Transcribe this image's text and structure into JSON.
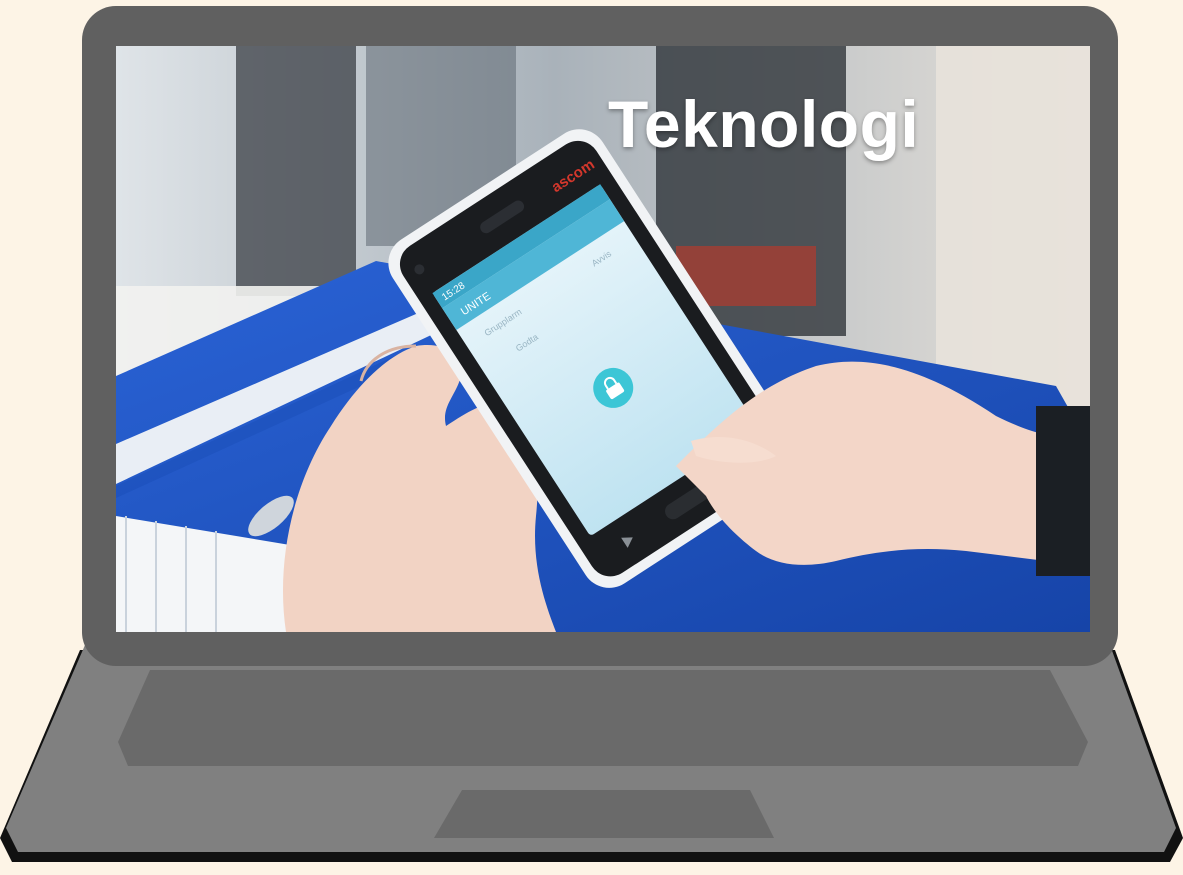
{
  "slide": {
    "title": "Teknologi"
  },
  "phone": {
    "brand": "ascom",
    "status_time": "15:28",
    "app_name": "UNITE",
    "row1": "Grupplarm",
    "row1_action": "Avvis",
    "row2": "Godta"
  },
  "colors": {
    "background": "#fdf4e6",
    "laptop_frame": "#606060",
    "laptop_base": "#808080",
    "keyboard": "#6a6a6a",
    "binder_blue": "#1e55c8",
    "lock_button": "#3cc6d6"
  }
}
